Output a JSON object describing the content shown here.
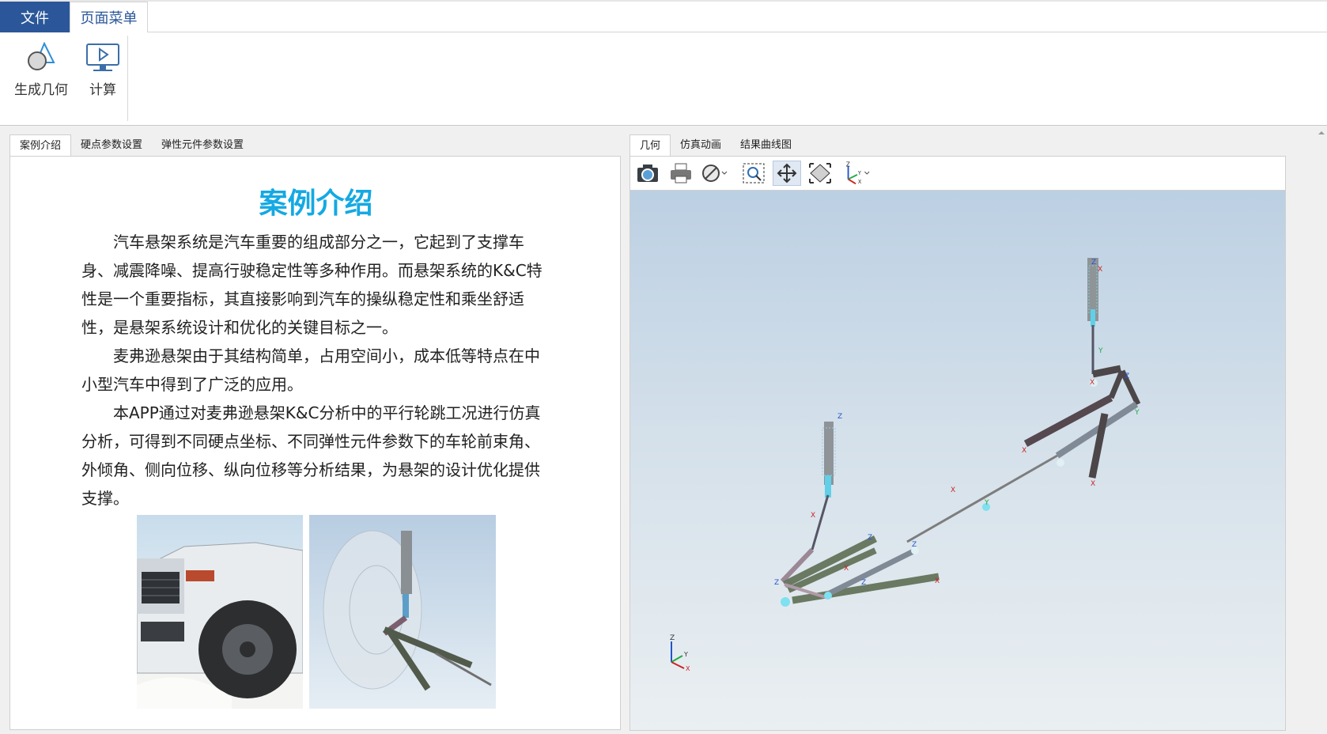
{
  "ribbon": {
    "tabs": [
      "文件",
      "页面菜单"
    ],
    "buttons": [
      {
        "label": "生成几何",
        "icon": "geometry-shapes-icon"
      },
      {
        "label": "计算",
        "icon": "compute-monitor-icon"
      }
    ]
  },
  "left_panel": {
    "tabs": [
      "案例介绍",
      "硬点参数设置",
      "弹性元件参数设置"
    ],
    "title": "案例介绍",
    "paragraphs": [
      "汽车悬架系统是汽车重要的组成部分之一，它起到了支撑车身、减震降噪、提高行驶稳定性等多种作用。而悬架系统的K&C特性是一个重要指标，其直接影响到汽车的操纵稳定性和乘坐舒适性，是悬架系统设计和优化的关键目标之一。",
      "麦弗逊悬架由于其结构简单，占用空间小，成本低等特点在中小型汽车中得到了广泛的应用。",
      "本APP通过对麦弗逊悬架K&C分析中的平行轮跳工况进行仿真分析，可得到不同硬点坐标、不同弹性元件参数下的车轮前束角、外倾角、侧向位移、纵向位移等分析结果，为悬架的设计优化提供支撑。"
    ]
  },
  "right_panel": {
    "tabs": [
      "几何",
      "仿真动画",
      "结果曲线图"
    ],
    "toolbar_icons": [
      "camera-icon",
      "print-icon",
      "hide-icon",
      "zoom-box-icon",
      "pan-icon",
      "fit-view-icon",
      "axes-orientation-icon"
    ],
    "axis_labels": {
      "z": "Z",
      "y": "Y",
      "x": "X"
    }
  },
  "colors": {
    "accent": "#2b579a",
    "title": "#14a9e3"
  }
}
